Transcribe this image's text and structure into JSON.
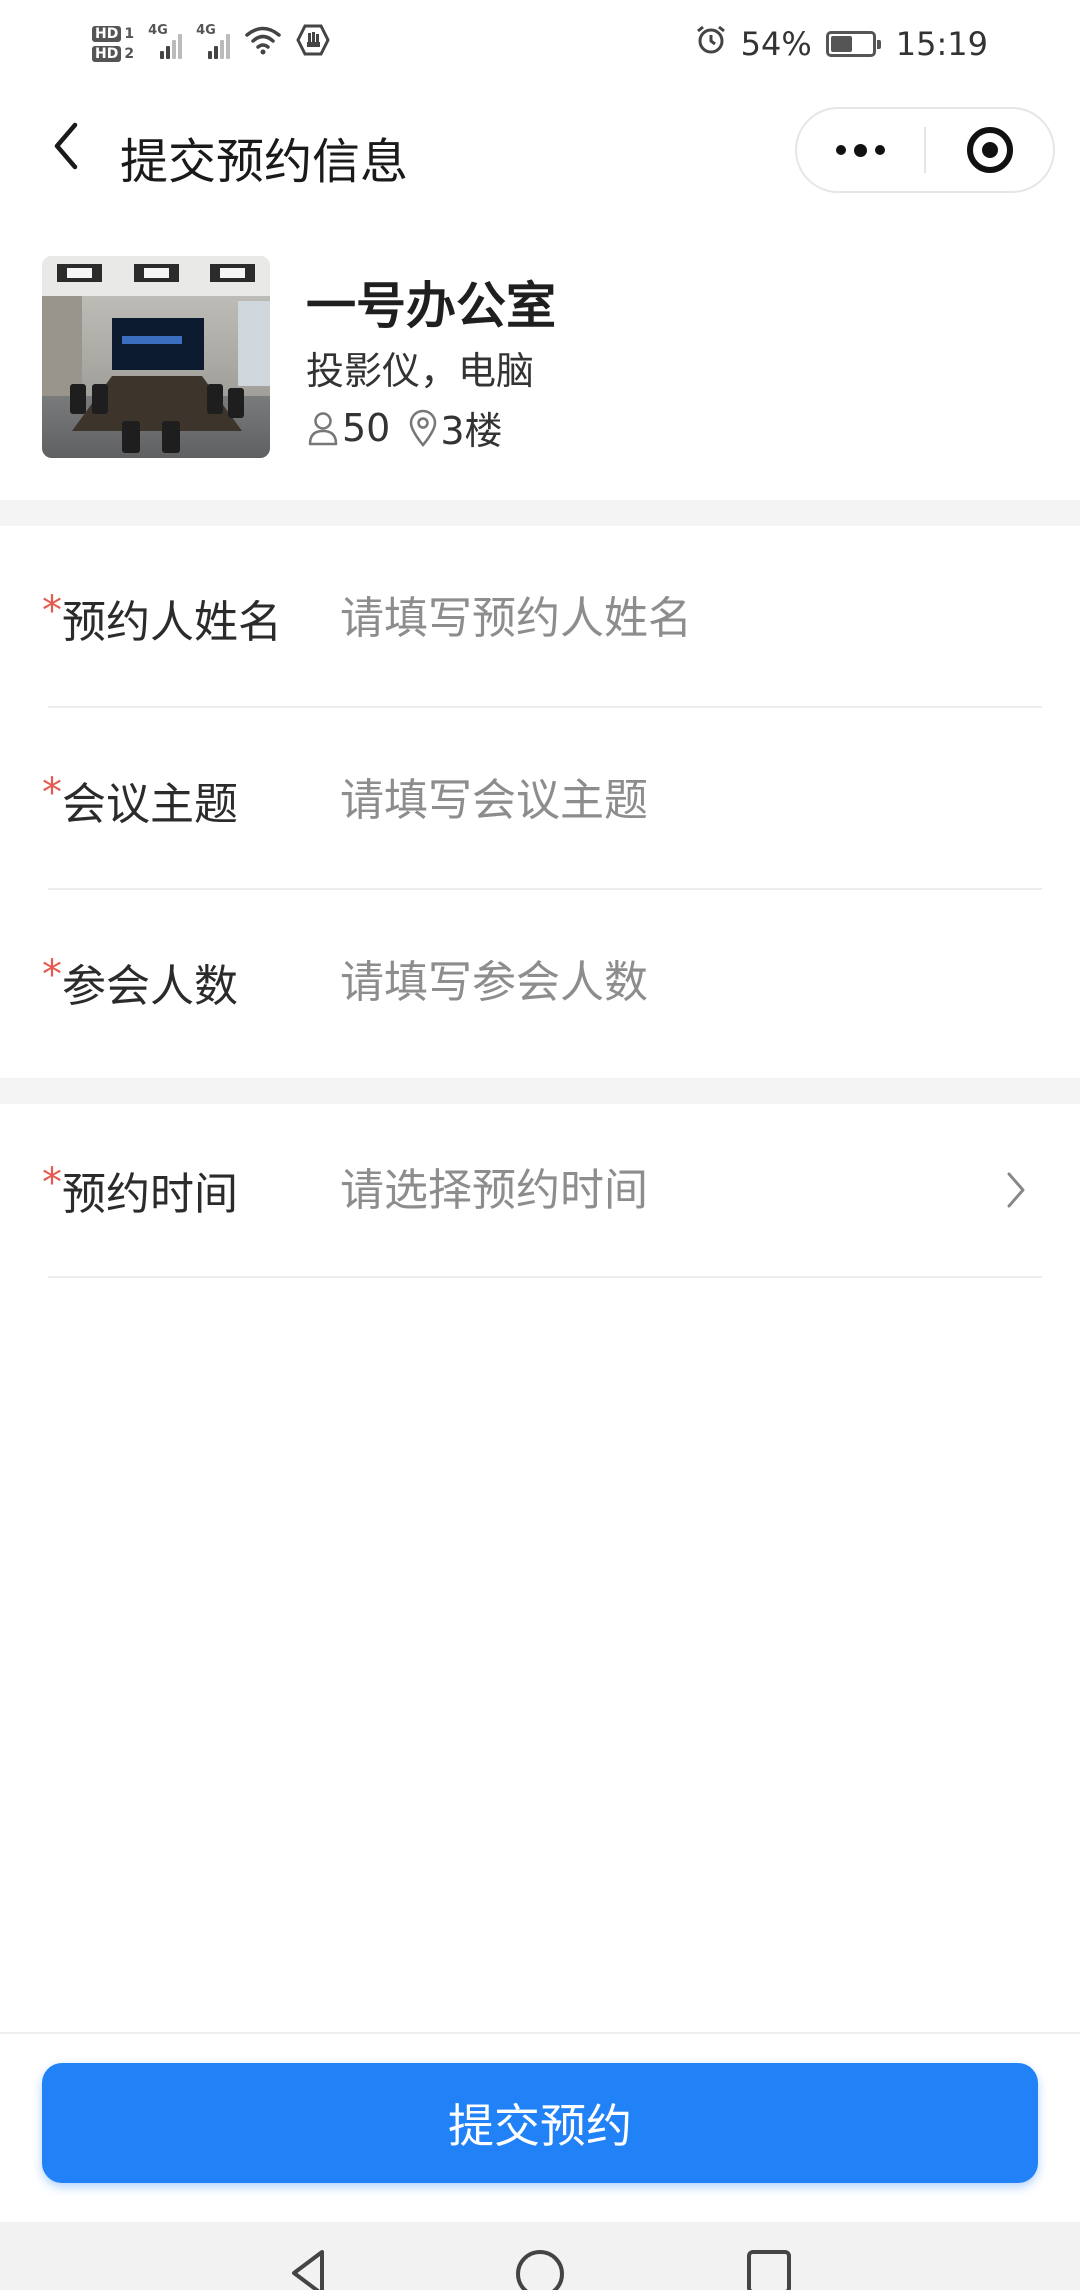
{
  "status_bar": {
    "hd1": "HD",
    "hd1_num": "1",
    "hd2": "HD",
    "hd2_num": "2",
    "net1": "4G",
    "net2": "4G",
    "battery_percent": "54%",
    "battery_level": 0.54,
    "time": "15:19"
  },
  "nav": {
    "title": "提交预约信息"
  },
  "room": {
    "name": "一号办公室",
    "equipment": "投影仪，电脑",
    "capacity": "50",
    "floor": "3楼"
  },
  "form": {
    "fields": [
      {
        "required_mark": "*",
        "label": "预约人姓名",
        "placeholder": "请填写预约人姓名",
        "value": ""
      },
      {
        "required_mark": "*",
        "label": "会议主题",
        "placeholder": "请填写会议主题",
        "value": ""
      },
      {
        "required_mark": "*",
        "label": "参会人数",
        "placeholder": "请填写参会人数",
        "value": ""
      },
      {
        "required_mark": "*",
        "label": "预约时间",
        "placeholder": "请选择预约时间",
        "value": ""
      }
    ]
  },
  "submit": {
    "label": "提交预约"
  },
  "colors": {
    "primary": "#2181f7",
    "required": "#e55a4f",
    "placeholder": "#8d8d8d",
    "separator": "#f4f4f4"
  },
  "icons": {
    "back": "chevron-left-icon",
    "more": "more-dots-icon",
    "close": "target-circle-icon",
    "person": "person-icon",
    "location": "location-pin-icon",
    "chevron": "chevron-right-icon",
    "nav_back": "triangle-back-icon",
    "nav_home": "circle-home-icon",
    "nav_recent": "square-recent-icon"
  }
}
